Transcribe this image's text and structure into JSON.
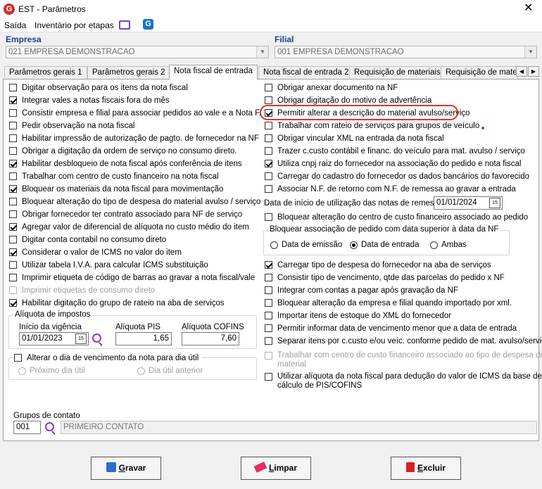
{
  "window": {
    "title": "EST - Parâmetros",
    "close": "✕"
  },
  "menu": {
    "items": [
      "Saída",
      "Inventário por etapas"
    ]
  },
  "empresa": {
    "label": "Empresa",
    "value": "021 EMPRESA DEMONSTRACAO"
  },
  "filial": {
    "label": "Filial",
    "value": "001 EMPRESA DEMONSTRACAO"
  },
  "tabs": [
    "Parâmetros gerais 1",
    "Parâmetros gerais 2",
    "Nota fiscal de entrada",
    "Nota fiscal de entrada 2",
    "Requisição de materiais",
    "Requisição de materi"
  ],
  "active_tab": 2,
  "left_checks": [
    {
      "label": "Digitar observação para os itens da nota fiscal",
      "checked": false,
      "disabled": false
    },
    {
      "label": "Integrar vales a notas fiscais fora do mês",
      "checked": true,
      "disabled": false
    },
    {
      "label": "Consistir empresa e filial para associar pedidos ao vale e a Nota F.",
      "checked": false,
      "disabled": false
    },
    {
      "label": "Pedir observação na nota fiscal",
      "checked": false,
      "disabled": false
    },
    {
      "label": "Habilitar impressão de autorização de pagto. de fornecedor na NF",
      "checked": false,
      "disabled": false
    },
    {
      "label": "Obrigar a digitação da ordem de serviço no consumo direto.",
      "checked": false,
      "disabled": false
    },
    {
      "label": "Habilitar desbloqueio de nota fiscal após conferência de itens",
      "checked": true,
      "disabled": false
    },
    {
      "label": "Trabalhar com centro de custo financeiro na nota fiscal",
      "checked": false,
      "disabled": false
    },
    {
      "label": "Bloquear os materiais da nota fiscal para movimentação",
      "checked": true,
      "disabled": false
    },
    {
      "label": "Bloquear alteração do tipo de despesa do material avulso / serviço",
      "checked": false,
      "disabled": false
    },
    {
      "label": "Obrigar fornecedor ter contrato associado para NF de serviço",
      "checked": false,
      "disabled": false
    },
    {
      "label": "Agregar valor de diferencial de alíquota no custo médio do item",
      "checked": true,
      "disabled": false
    },
    {
      "label": "Digitar conta contabil no consumo direto",
      "checked": false,
      "disabled": false
    },
    {
      "label": "Considerar o valor de ICMS no valor do item",
      "checked": true,
      "disabled": false
    },
    {
      "label": "Utilizar tabela I.V.A. para calcular ICMS substituição",
      "checked": false,
      "disabled": false
    },
    {
      "label": "Imprimir etiqueta de código de barras ao gravar a nota fiscal/vale",
      "checked": false,
      "disabled": false
    },
    {
      "label": "Imprimir etiquetas de consumo direto",
      "checked": false,
      "disabled": true
    },
    {
      "label": "Habilitar digitação do grupo de rateio na aba de serviços",
      "checked": true,
      "disabled": false
    }
  ],
  "aliquota": {
    "title": "Alíquota de impostos",
    "inicio_label": "Início da vigência",
    "inicio_value": "01/01/2023",
    "pis_label": "Alíquota PIS",
    "pis_value": "1,65",
    "cofins_label": "Alíquota COFINS",
    "cofins_value": "7,60"
  },
  "vencimento": {
    "label": "Alterar o dia de vencimento da nota para dia útil",
    "opt1": "Próximo dia útil",
    "opt2": "Dia útil anterior"
  },
  "right_checks_a": [
    {
      "label": "Obrigar anexar documento na NF",
      "checked": false,
      "disabled": false
    },
    {
      "label": "Obrigar digitação do motivo de advertência",
      "checked": false,
      "disabled": false
    },
    {
      "label": "Permitir alterar a descrição do material avulso/serviço",
      "checked": true,
      "disabled": false
    },
    {
      "label": "Trabalhar com rateio de serviços para grupos de veículo",
      "checked": false,
      "disabled": false
    },
    {
      "label": "Obrigar vincular XML na entrada da nota fiscal",
      "checked": false,
      "disabled": false
    },
    {
      "label": "Trazer c.custo contábil e financ. do veículo para mat. avulso / serviço",
      "checked": false,
      "disabled": false
    },
    {
      "label": "Utiliza cnpj raiz do fornecedor na associação do pedido e nota fiscal",
      "checked": true,
      "disabled": false
    },
    {
      "label": "Carregar do cadastro do fornecedor os dados bancários do favorecido",
      "checked": false,
      "disabled": false
    },
    {
      "label": "Associar N.F. de retorno com N.F. de remessa ao gravar a entrada",
      "checked": false,
      "disabled": false
    }
  ],
  "data_inicio": {
    "label": "Data de início de utilização das notas de remessa",
    "value": "01/01/2024"
  },
  "bloq_ccusto": {
    "label": "Bloquear alteração do centro de custo financeiro associado ao pedido",
    "checked": false
  },
  "bloq_pedido": {
    "title": "Bloquear associação de pedido com data superior à data da NF",
    "options": [
      "Data de emissão",
      "Data de entrada",
      "Ambas"
    ],
    "selected": 1
  },
  "right_checks_b": [
    {
      "label": "Carregar tipo de despesa do fornecedor na aba de serviços",
      "checked": true,
      "disabled": false
    },
    {
      "label": "Consistir tipo de vencimento, qtde das parcelas do pedido x NF",
      "checked": false,
      "disabled": false
    },
    {
      "label": "Integrar com contas a pagar após gravação da NF",
      "checked": false,
      "disabled": false
    },
    {
      "label": "Bloquear alteração da empresa e filial quando importado por xml.",
      "checked": false,
      "disabled": false
    },
    {
      "label": "Importar itens de estoque do XML do fornecedor",
      "checked": false,
      "disabled": false
    },
    {
      "label": "Permitir informar data de vencimento menor que a data de entrada",
      "checked": false,
      "disabled": false
    },
    {
      "label": "Separar itens por c.custo e/ou veíc. conforme pedido de mat. avulso/serviço",
      "checked": false,
      "disabled": false
    }
  ],
  "trab_ccusto": {
    "line1": "Trabalhar com centro de custo financeiro associado ao tipo de despesa do",
    "line2": "material"
  },
  "utilizar_aliq": {
    "line1": "Utilizar alíquota da nota fiscal para dedução do valor de ICMS da base de",
    "line2": "cálculo de PIS/COFINS"
  },
  "grupos": {
    "label": "Grupos de contato",
    "code": "001",
    "desc": "PRIMEIRO CONTATO"
  },
  "buttons": {
    "gravar_u": "G",
    "gravar_rest": "ravar",
    "limpar_u": "L",
    "limpar_rest": "impar",
    "excluir_u": "E",
    "excluir_rest": "xcluir"
  }
}
